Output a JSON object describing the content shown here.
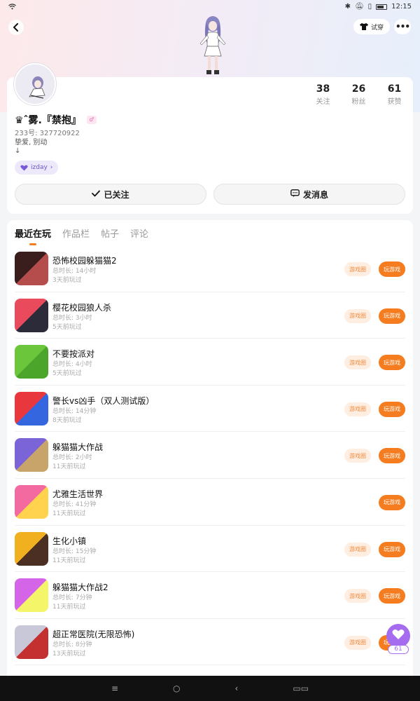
{
  "status": {
    "time": "12:15"
  },
  "header": {
    "outfit_label": "试穿"
  },
  "profile": {
    "name": "♛ˆ雾.『禁抱』",
    "gender_symbol": "♂",
    "uid": "233号: 327720922",
    "bio_line1": "挚爱, 别动",
    "bio_line2": "↓",
    "tag": "izday",
    "stats": [
      {
        "value": "38",
        "label": "关注"
      },
      {
        "value": "26",
        "label": "粉丝"
      },
      {
        "value": "61",
        "label": "获赞"
      }
    ],
    "follow_label": "已关注",
    "message_label": "发消息"
  },
  "tabs": [
    "最近在玩",
    "作品栏",
    "帖子",
    "评论"
  ],
  "games": [
    {
      "name": "恐怖校园躲猫猫2",
      "duration": "总时长: 14小时",
      "last": "3天前玩过",
      "circle": "游戏圈",
      "play": "玩游戏",
      "color1": "#3a1d1d",
      "color2": "#b64d4d"
    },
    {
      "name": "樱花校园狼人杀",
      "duration": "总时长: 3小时",
      "last": "5天前玩过",
      "circle": "游戏圈",
      "play": "玩游戏",
      "color1": "#e94b5d",
      "color2": "#2b2b3a"
    },
    {
      "name": "不要按派对",
      "duration": "总时长: 4小时",
      "last": "5天前玩过",
      "circle": "游戏圈",
      "play": "玩游戏",
      "color1": "#6bc63c",
      "color2": "#4aa52a"
    },
    {
      "name": "警长vs凶手（双人测试版）",
      "duration": "总时长: 14分钟",
      "last": "8天前玩过",
      "circle": "游戏圈",
      "play": "玩游戏",
      "color1": "#e8383d",
      "color2": "#3466e0"
    },
    {
      "name": "躲猫猫大作战",
      "duration": "总时长: 2小时",
      "last": "11天前玩过",
      "circle": "游戏圈",
      "play": "玩游戏",
      "color1": "#7b64d8",
      "color2": "#c8a46a"
    },
    {
      "name": "尤雅生活世界",
      "duration": "总时长: 41分钟",
      "last": "11天前玩过",
      "circle": "",
      "play": "玩游戏",
      "color1": "#f26aa0",
      "color2": "#ffd34d"
    },
    {
      "name": "生化小镇",
      "duration": "总时长: 15分钟",
      "last": "11天前玩过",
      "circle": "游戏圈",
      "play": "玩游戏",
      "color1": "#f0b020",
      "color2": "#4a2f22"
    },
    {
      "name": "躲猫猫大作战2",
      "duration": "总时长: 7分钟",
      "last": "11天前玩过",
      "circle": "游戏圈",
      "play": "玩游戏",
      "color1": "#d565e8",
      "color2": "#f5f56a"
    },
    {
      "name": "超正常医院(无限恐怖)",
      "duration": "总时长: 8分钟",
      "last": "13天前玩过",
      "circle": "游戏圈",
      "play": "玩游戏",
      "color1": "#c8c8d8",
      "color2": "#c43030"
    }
  ],
  "fab": {
    "count": "61"
  }
}
